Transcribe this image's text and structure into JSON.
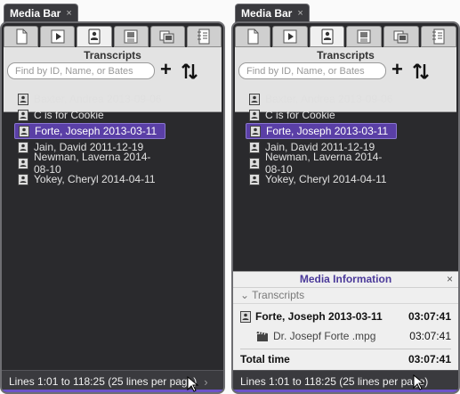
{
  "panels": [
    {
      "tab_title": "Media Bar",
      "tab_close": "×",
      "section_title": "Transcripts",
      "search_placeholder": "Find by ID, Name, or Bates",
      "add_label": "+",
      "items": [
        "Baxter, Andrea 2013-09-06",
        "C is for Cookie",
        "Forte, Joseph 2013-03-11",
        "Jain, David 2011-12-19",
        "Newman, Laverna 2014-08-10",
        "Yokey, Cheryl 2014-04-11"
      ],
      "selected_index": 2,
      "status": "Lines 1:01 to 118:25 (25 lines per page)",
      "status_arrow": "›"
    },
    {
      "tab_title": "Media Bar",
      "tab_close": "×",
      "section_title": "Transcripts",
      "search_placeholder": "Find by ID, Name, or Bates",
      "add_label": "+",
      "items": [
        "Baxter, Andrea 2013-09-06",
        "C is for Cookie",
        "Forte, Joseph 2013-03-11",
        "Jain, David 2011-12-19",
        "Newman, Laverna 2014-08-10",
        "Yokey, Cheryl 2014-04-11"
      ],
      "selected_index": 2,
      "status": "Lines 1:01 to 118:25 (25 lines per page)",
      "media_info": {
        "title": "Media Information",
        "close": "×",
        "section": "Transcripts",
        "transcript_name": "Forte, Joseph 2013-03-11",
        "transcript_duration": "03:07:41",
        "file_name": "Dr. Josepf Forte .mpg",
        "file_duration": "03:07:41",
        "total_label": "Total time",
        "total_duration": "03:07:41"
      }
    }
  ],
  "colors": {
    "accent": "#5a3fa6",
    "panel_bg": "#2a2a2d",
    "toolbar_bg": "#e3e3e3"
  }
}
